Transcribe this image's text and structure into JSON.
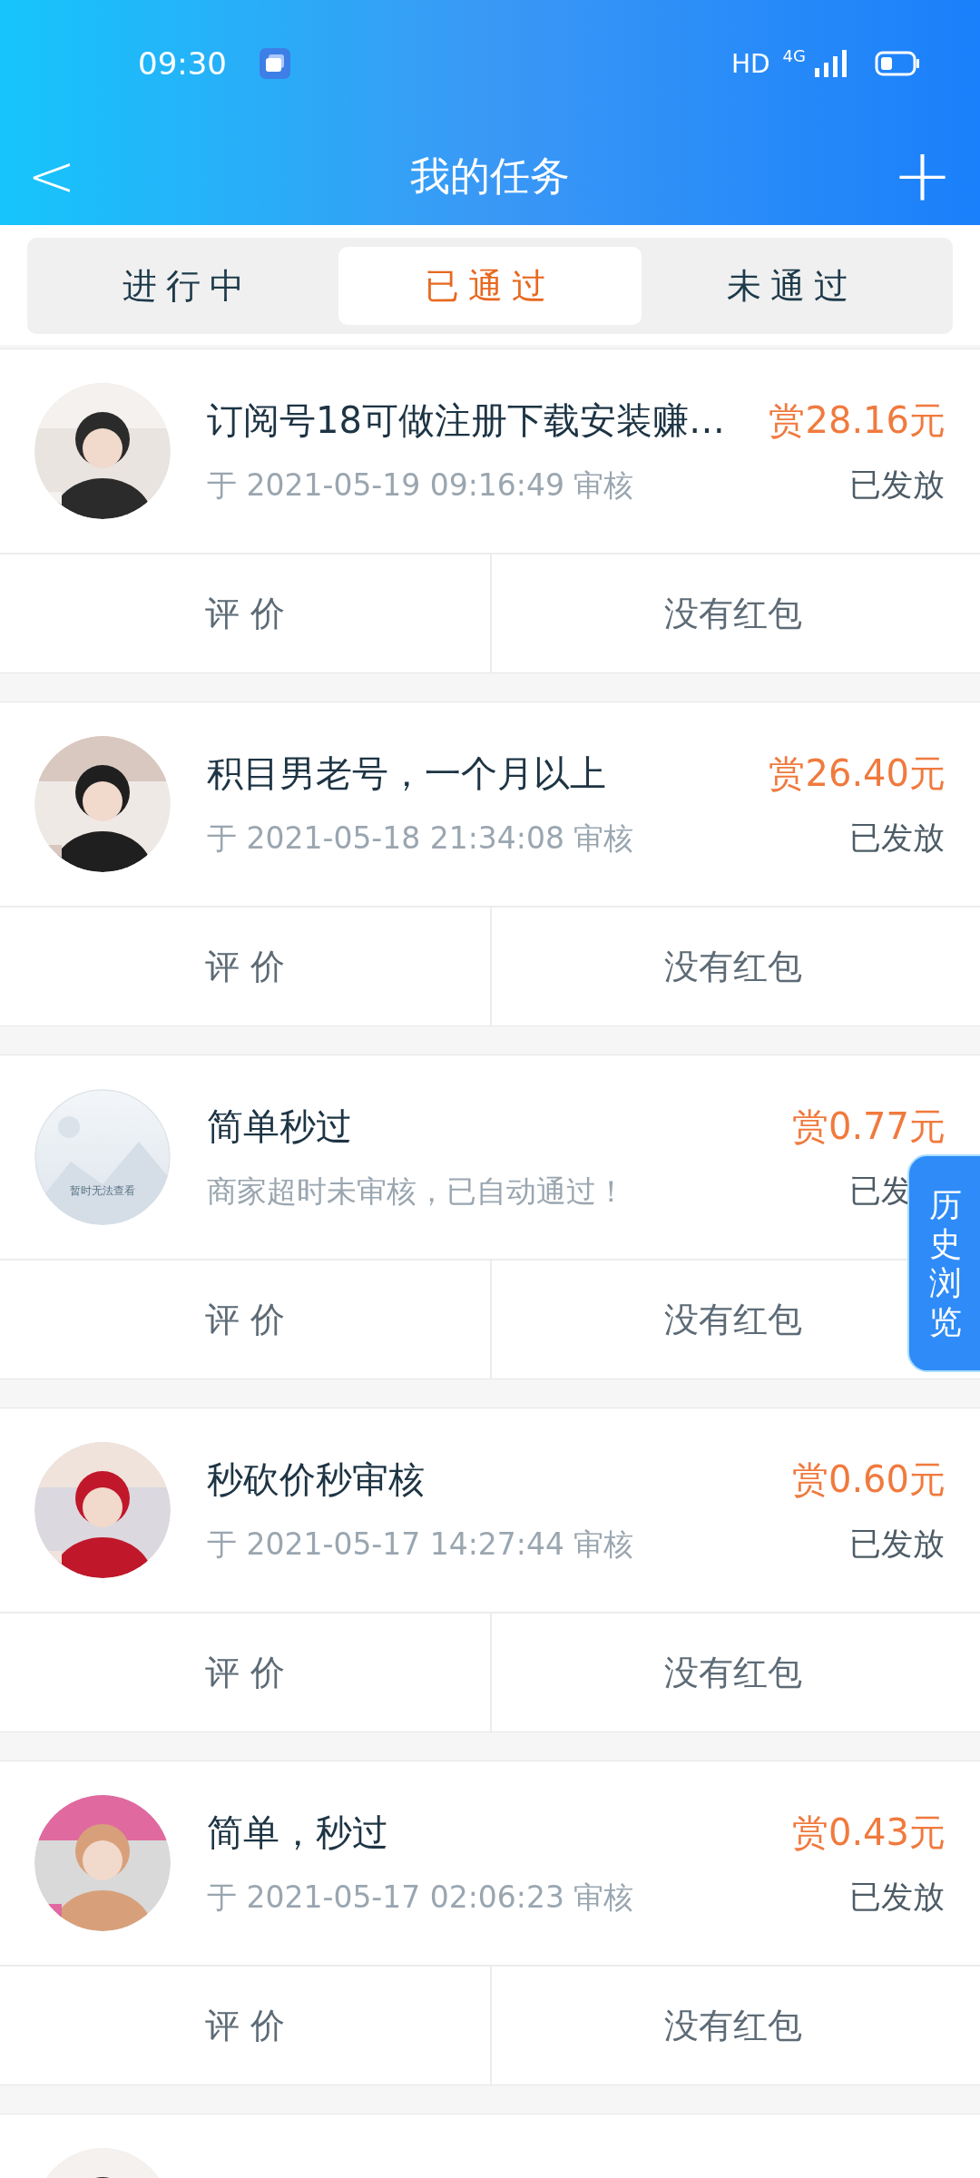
{
  "status_bar": {
    "time": "09:30",
    "hd": "HD",
    "network": "4G"
  },
  "header": {
    "back": "<",
    "title": "我的任务",
    "add": "+"
  },
  "tabs": [
    {
      "label": "进行中",
      "selected": false
    },
    {
      "label": "已通过",
      "selected": true
    },
    {
      "label": "未通过",
      "selected": false
    }
  ],
  "tasks": [
    {
      "avatar": {
        "kind": "picture"
      },
      "title": "订阅号18可做注册下载安装赚…",
      "subtitle": "于 2021-05-19 09:16:49 审核",
      "reward": "赏28.16元",
      "status": "已发放",
      "actions": [
        "评 价",
        "没有红包"
      ]
    },
    {
      "avatar": {
        "kind": "picture"
      },
      "title": "积目男老号，一个月以上",
      "subtitle": "于 2021-05-18 21:34:08 审核",
      "reward": "赏26.40元",
      "status": "已发放",
      "actions": [
        "评 价",
        "没有红包"
      ]
    },
    {
      "avatar": {
        "kind": "placeholder",
        "text": "暂时无法查看"
      },
      "title": "简单秒过",
      "subtitle": "商家超时未审核，已自动通过！",
      "reward": "赏0.77元",
      "status": "已发",
      "actions": [
        "评 价",
        "没有红包"
      ]
    },
    {
      "avatar": {
        "kind": "picture"
      },
      "title": "秒砍价秒审核",
      "subtitle": "于 2021-05-17 14:27:44 审核",
      "reward": "赏0.60元",
      "status": "已发放",
      "actions": [
        "评 价",
        "没有红包"
      ]
    },
    {
      "avatar": {
        "kind": "picture"
      },
      "title": "简单，秒过",
      "subtitle": "于 2021-05-17 02:06:23 审核",
      "reward": "赏0.43元",
      "status": "已发放",
      "actions": [
        "评 价",
        "没有红包"
      ]
    },
    {
      "avatar": {
        "kind": "picture"
      }
    }
  ],
  "floating_button": {
    "label": "历史浏览"
  }
}
